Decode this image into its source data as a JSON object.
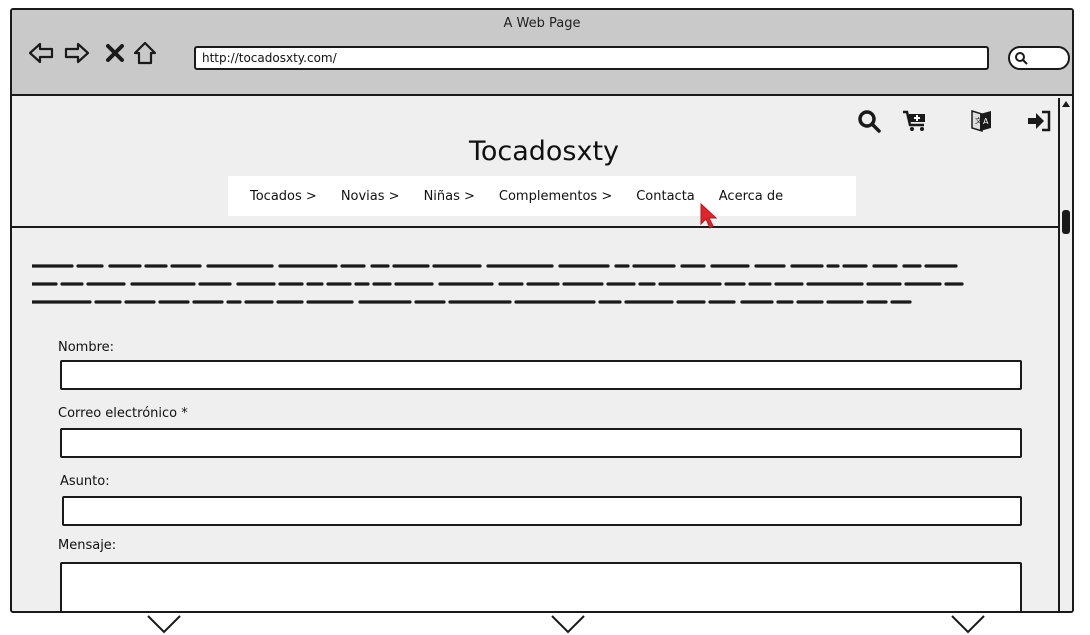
{
  "browser": {
    "window_title": "A Web Page",
    "url": "http://tocadosxty.com/"
  },
  "site": {
    "title": "Tocadosxty",
    "nav": [
      {
        "label": "Tocados >"
      },
      {
        "label": "Novias >"
      },
      {
        "label": "Niñas >"
      },
      {
        "label": "Complementos >"
      },
      {
        "label": "Contacta"
      },
      {
        "label": "Acerca de"
      }
    ],
    "header_icons": [
      "search-icon",
      "cart-add-icon",
      "language-icon",
      "login-icon"
    ]
  },
  "form": {
    "name_label": "Nombre:",
    "email_label": "Correo electrónico *",
    "subject_label": "Asunto:",
    "message_label": "Mensaje:",
    "name_value": "",
    "email_value": "",
    "subject_value": "",
    "message_value": ""
  },
  "colors": {
    "titlebar": "#c9c9c9",
    "page_background": "#efefef",
    "cursor": "#e0242b",
    "ink": "#1a1a1a"
  }
}
